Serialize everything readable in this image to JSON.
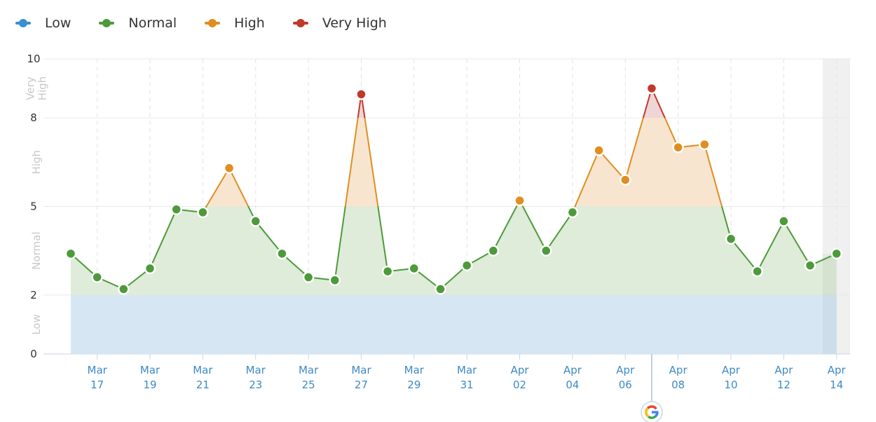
{
  "legend": [
    {
      "label": "Low",
      "color": "#3a8fd1"
    },
    {
      "label": "Normal",
      "color": "#4d9a3a"
    },
    {
      "label": "High",
      "color": "#e08e20"
    },
    {
      "label": "Very High",
      "color": "#c0392b"
    }
  ],
  "chart_data": {
    "type": "area",
    "title": "",
    "xlabel": "",
    "ylabel": "",
    "ylim": [
      0,
      10
    ],
    "yticks": [
      0,
      2,
      5,
      8,
      10
    ],
    "bands": [
      {
        "name": "Low",
        "from": 0,
        "to": 2,
        "color": "#3a8fd1"
      },
      {
        "name": "Normal",
        "from": 2,
        "to": 5,
        "color": "#4d9a3a"
      },
      {
        "name": "High",
        "from": 5,
        "to": 8,
        "color": "#e08e20"
      },
      {
        "name": "Very High",
        "from": 8,
        "to": 10,
        "color": "#c0392b"
      }
    ],
    "band_labels": [
      "Low",
      "Normal",
      "High",
      "Very High"
    ],
    "x": [
      "Mar 16",
      "Mar 17",
      "Mar 18",
      "Mar 19",
      "Mar 20",
      "Mar 21",
      "Mar 22",
      "Mar 23",
      "Mar 24",
      "Mar 25",
      "Mar 26",
      "Mar 27",
      "Mar 28",
      "Mar 29",
      "Mar 30",
      "Mar 31",
      "Apr 01",
      "Apr 02",
      "Apr 03",
      "Apr 04",
      "Apr 05",
      "Apr 06",
      "Apr 07",
      "Apr 08",
      "Apr 09",
      "Apr 10",
      "Apr 11",
      "Apr 12",
      "Apr 13",
      "Apr 14"
    ],
    "values": [
      3.4,
      2.6,
      2.2,
      2.9,
      4.9,
      4.8,
      6.3,
      4.5,
      3.4,
      2.6,
      2.5,
      8.8,
      2.8,
      2.9,
      2.2,
      3.0,
      3.5,
      5.2,
      3.5,
      4.8,
      6.9,
      5.9,
      9.0,
      7.0,
      7.1,
      3.9,
      2.8,
      4.5,
      3.0,
      3.4
    ],
    "xtick_labels": [
      {
        "index": 1,
        "month": "Mar",
        "day": "17"
      },
      {
        "index": 3,
        "month": "Mar",
        "day": "19"
      },
      {
        "index": 5,
        "month": "Mar",
        "day": "21"
      },
      {
        "index": 7,
        "month": "Mar",
        "day": "23"
      },
      {
        "index": 9,
        "month": "Mar",
        "day": "25"
      },
      {
        "index": 11,
        "month": "Mar",
        "day": "27"
      },
      {
        "index": 13,
        "month": "Mar",
        "day": "29"
      },
      {
        "index": 15,
        "month": "Mar",
        "day": "31"
      },
      {
        "index": 17,
        "month": "Apr",
        "day": "02"
      },
      {
        "index": 19,
        "month": "Apr",
        "day": "04"
      },
      {
        "index": 21,
        "month": "Apr",
        "day": "06"
      },
      {
        "index": 23,
        "month": "Apr",
        "day": "08"
      },
      {
        "index": 25,
        "month": "Apr",
        "day": "10"
      },
      {
        "index": 27,
        "month": "Apr",
        "day": "12"
      },
      {
        "index": 29,
        "month": "Apr",
        "day": "14"
      }
    ],
    "annotations": [
      {
        "type": "google-update-marker",
        "at_index": 22.0,
        "label": "G"
      }
    ],
    "highlighted_range": {
      "from_index": 29,
      "to_index": 29,
      "note": "incomplete day shaded"
    },
    "grid": true,
    "legend_position": "top-left"
  }
}
